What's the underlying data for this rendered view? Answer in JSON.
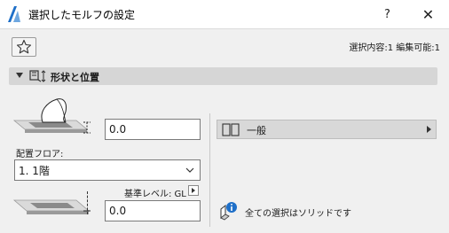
{
  "window": {
    "title": "選択したモルフの設定",
    "help_label": "?",
    "close_label": "✕"
  },
  "toolbar": {
    "favorites_icon": "star-icon",
    "selection_info": "選択内容:1 編集可能:1"
  },
  "section": {
    "title": "形状と位置",
    "icon": "morph-geometry-icon",
    "expanded": true
  },
  "geometry": {
    "top_offset_value": "0.0",
    "floor_label": "配置フロア:",
    "floor_value": "1. 1階",
    "ref_level_label": "基準レベル: GL",
    "bottom_offset_value": "0.0"
  },
  "right_panel": {
    "general_label": "一般",
    "solid_note": "全ての選択はソリッドです"
  },
  "colors": {
    "accent_blue": "#1e6fc8",
    "header_gray": "#d6d6d6",
    "panel_bg": "#f0f0f0"
  }
}
